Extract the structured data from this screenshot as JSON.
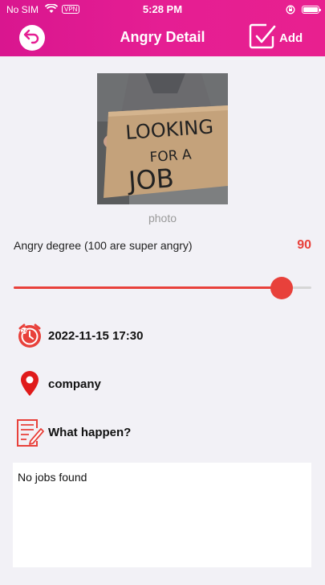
{
  "status_bar": {
    "carrier": "No SIM",
    "vpn": "VPN",
    "time": "5:28 PM"
  },
  "header": {
    "title": "Angry Detail",
    "add_label": "Add"
  },
  "photo": {
    "caption": "photo",
    "sign_line1": "LOOKING",
    "sign_line2": "FOR A",
    "sign_line3": "JOB"
  },
  "degree": {
    "label": "Angry degree (100 are super angry)",
    "value": "90",
    "level_fraction": 0.9
  },
  "datetime": "2022-11-15 17:30",
  "place": "company",
  "what_label": "What happen?",
  "description": "No jobs found",
  "colors": {
    "header_pink": "#e51e93",
    "accent_red": "#e8413b",
    "background": "#f2f1f6"
  },
  "icons": {
    "back": "back-arrow-icon",
    "add": "checkbox-icon",
    "clock": "clock-icon",
    "location": "location-pin-icon",
    "note": "note-edit-icon"
  }
}
